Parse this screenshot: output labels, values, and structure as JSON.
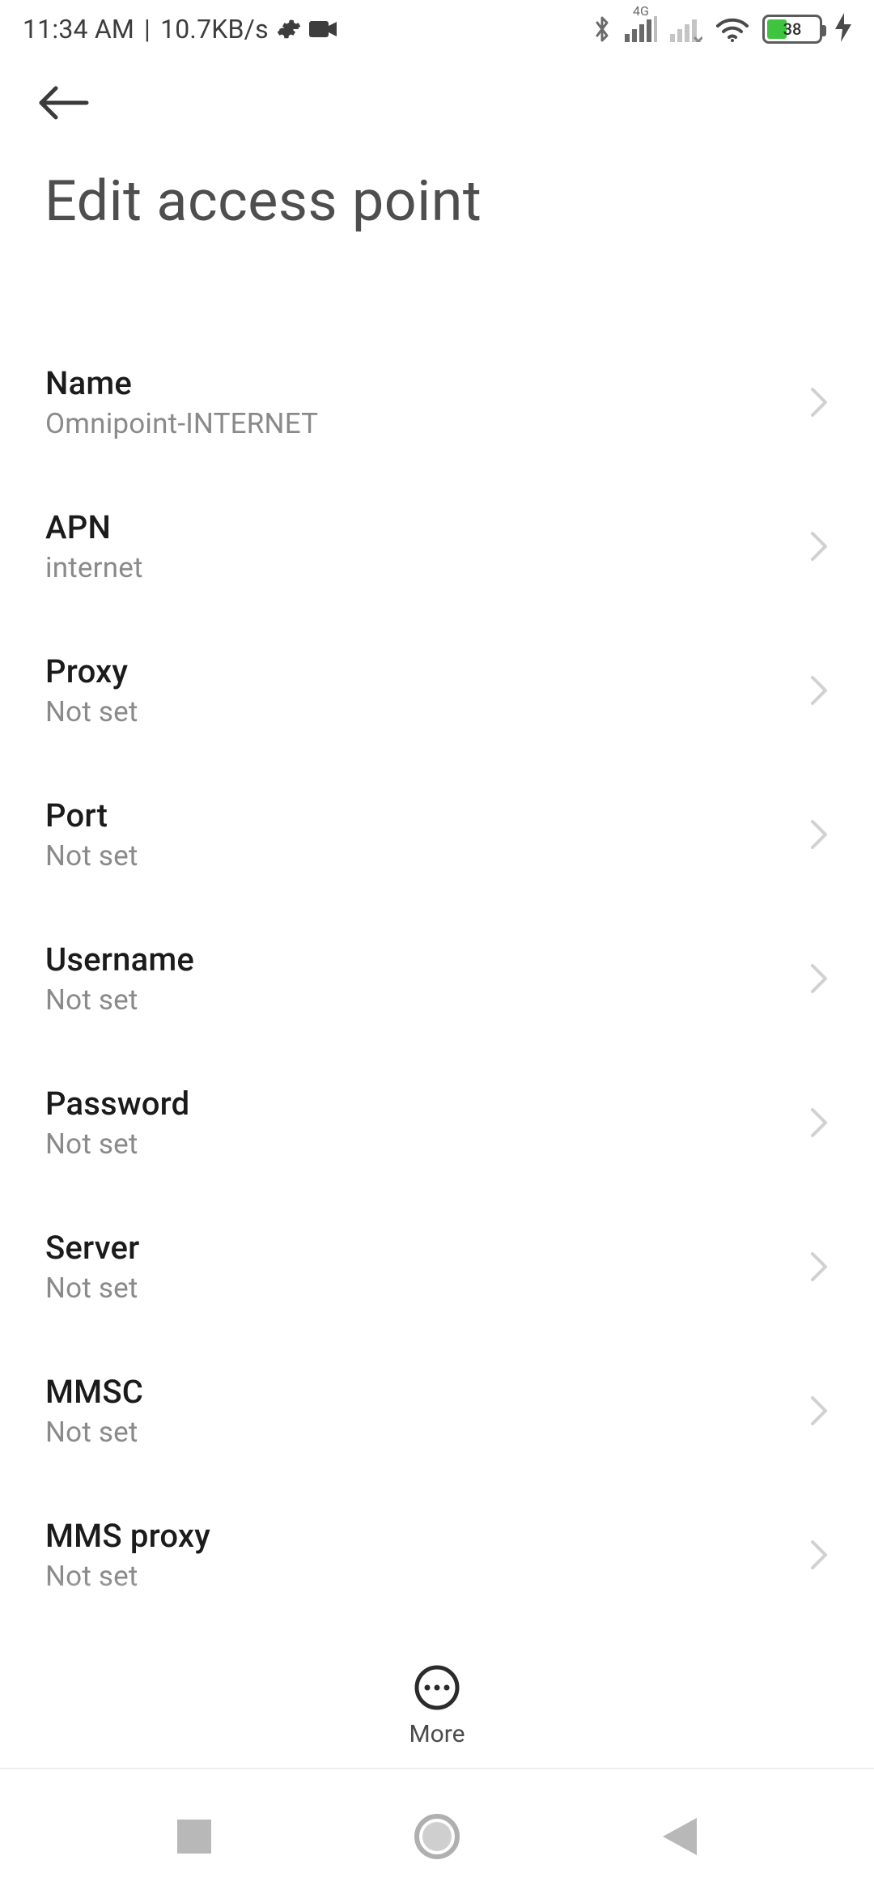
{
  "status": {
    "time": "11:34 AM",
    "net_speed": "10.7KB/s",
    "signal_label": "4G",
    "battery_pct": "38"
  },
  "header": {
    "title": "Edit access point"
  },
  "items": [
    {
      "label": "Name",
      "value": "Omnipoint-INTERNET"
    },
    {
      "label": "APN",
      "value": "internet"
    },
    {
      "label": "Proxy",
      "value": "Not set"
    },
    {
      "label": "Port",
      "value": "Not set"
    },
    {
      "label": "Username",
      "value": "Not set"
    },
    {
      "label": "Password",
      "value": "Not set"
    },
    {
      "label": "Server",
      "value": "Not set"
    },
    {
      "label": "MMSC",
      "value": "Not set"
    },
    {
      "label": "MMS proxy",
      "value": "Not set"
    }
  ],
  "actions": {
    "more_label": "More"
  }
}
